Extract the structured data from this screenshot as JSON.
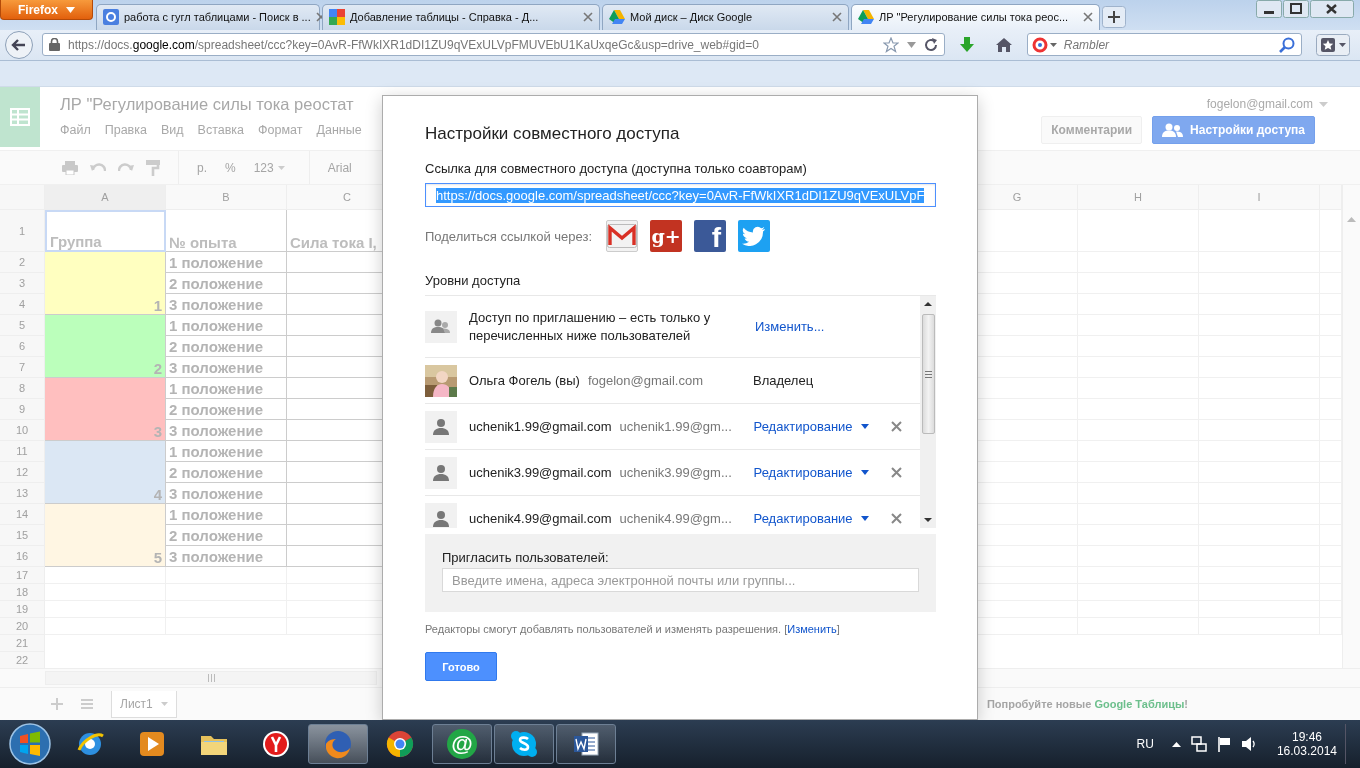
{
  "browser": {
    "menu_button": "Firefox",
    "tabs": [
      {
        "title": "работа с гугл таблицами - Поиск в ...",
        "selected": false
      },
      {
        "title": "Добавление таблицы - Справка - Д...",
        "selected": false
      },
      {
        "title": "Мой диск – Диск Google",
        "selected": false
      },
      {
        "title": "ЛР \"Регулирование силы тока реос...",
        "selected": true
      }
    ],
    "url": {
      "scheme": "https://docs.",
      "domain": "google.com",
      "rest": "/spreadsheet/ccc?key=0AvR-FfWkIXR1dDI1ZU9qVExULVpFMUVEbU1KaUxqeGc&usp=drive_web#gid=0"
    },
    "search": {
      "placeholder": "Rambler"
    }
  },
  "sheet": {
    "title": "ЛР \"Регулирование силы тока реостат",
    "menu": [
      "Файл",
      "Правка",
      "Вид",
      "Вставка",
      "Формат",
      "Данные"
    ],
    "account": "fogelon@gmail.com",
    "buttons": [
      {
        "label": "Комментарии",
        "kind": "plain"
      },
      {
        "label": "Настройки доступа",
        "kind": "primary"
      }
    ],
    "toolbar": {
      "currency": "р.",
      "percent": "%",
      "number_format": "123",
      "font": "Arial"
    },
    "columns_left": [
      "A",
      "B",
      "C"
    ],
    "columns_right": [
      "G",
      "H",
      "I"
    ],
    "row_numbers": [
      "1",
      "2",
      "3",
      "4",
      "5",
      "6",
      "7",
      "8",
      "9",
      "10",
      "11",
      "12",
      "13",
      "14",
      "15",
      "16",
      "17",
      "18",
      "19",
      "20",
      "21",
      "22"
    ],
    "header_row": [
      {
        "text": "Группа",
        "selected": true
      },
      {
        "text": "№ опыта",
        "selected": false
      },
      {
        "text": "Сила тока I,",
        "selected": false
      }
    ],
    "groups": [
      {
        "label": "1",
        "color": "#ffffc0",
        "rows": [
          "1 положение",
          "2 положение",
          "3 положение"
        ]
      },
      {
        "label": "2",
        "color": "#bbffbb",
        "rows": [
          "1 положение",
          "2 положение",
          "3 положение"
        ]
      },
      {
        "label": "3",
        "color": "#ffbfbf",
        "rows": [
          "1 положение",
          "2 положение",
          "3 положение"
        ]
      },
      {
        "label": "4",
        "color": "#dbe7f4",
        "rows": [
          "1 положение",
          "2 положение",
          "3 положение"
        ]
      },
      {
        "label": "5",
        "color": "#fff6e3",
        "rows": [
          "1 положение",
          "2 положение",
          "3 положение"
        ]
      }
    ],
    "sheet_tabs": [
      {
        "label": "Лист1",
        "selected": true
      }
    ],
    "promo": {
      "before": "Попробуйте новые",
      "link": "Google Таблицы",
      "after": "!"
    }
  },
  "dialog": {
    "title": "Настройки совместного доступа",
    "link_label": "Ссылка для совместного доступа (доступна только соавторам)",
    "link": {
      "value": "https://docs.google.com/spreadsheet/ccc?key=0AvR-FfWkIXR1dDI1ZU9qVExULVpF",
      "text_selected": true
    },
    "share_label": "Поделиться ссылкой через:",
    "share_targets": [
      {
        "kind": "mail"
      },
      {
        "kind": "plus",
        "glyph": "g+"
      },
      {
        "kind": "f",
        "glyph": "f"
      },
      {
        "kind": "bird"
      }
    ],
    "levels_title": "Уровни доступа",
    "entries": [
      {
        "kind": "visibility",
        "text": "Доступ по приглашению – есть только у перечисленных ниже пользователей",
        "action": "Изменить..."
      },
      {
        "kind": "owner",
        "name": "Ольга Фогель (вы)",
        "email": "fogelon@gmail.com",
        "role": "Владелец"
      },
      {
        "kind": "editor",
        "name": "uchenik1.99@gmail.com",
        "email": "uchenik1.99@gm...",
        "role": "Редактирование"
      },
      {
        "kind": "editor",
        "name": "uchenik3.99@gmail.com",
        "email": "uchenik3.99@gm...",
        "role": "Редактирование"
      },
      {
        "kind": "editor",
        "name": "uchenik4.99@gmail.com",
        "email": "uchenik4.99@gm...",
        "role": "Редактирование"
      }
    ],
    "invite": {
      "label": "Пригласить пользователей:",
      "placeholder": "Введите имена, адреса электронной почты или группы..."
    },
    "note": {
      "text": "Редакторы смогут добавлять пользователей и изменять разрешения.",
      "open": "[",
      "link": "Изменить",
      "close": "]"
    },
    "done_button": "Готово"
  },
  "taskbar": {
    "apps": [
      {
        "kind": "globe",
        "running": false,
        "selected": false
      },
      {
        "kind": "player",
        "running": false,
        "selected": false
      },
      {
        "kind": "folder",
        "running": false,
        "selected": false
      },
      {
        "kind": "redball",
        "running": false,
        "selected": false
      },
      {
        "kind": "fox",
        "running": true,
        "selected": true
      },
      {
        "kind": "wheel",
        "running": false,
        "selected": false
      },
      {
        "kind": "mail",
        "glyph": "@",
        "running": true,
        "selected": false
      },
      {
        "kind": "bubble",
        "running": true,
        "selected": false
      },
      {
        "kind": "doc",
        "running": true,
        "selected": false
      }
    ],
    "language": "RU",
    "time": "19:46",
    "date": "16.03.2014"
  }
}
